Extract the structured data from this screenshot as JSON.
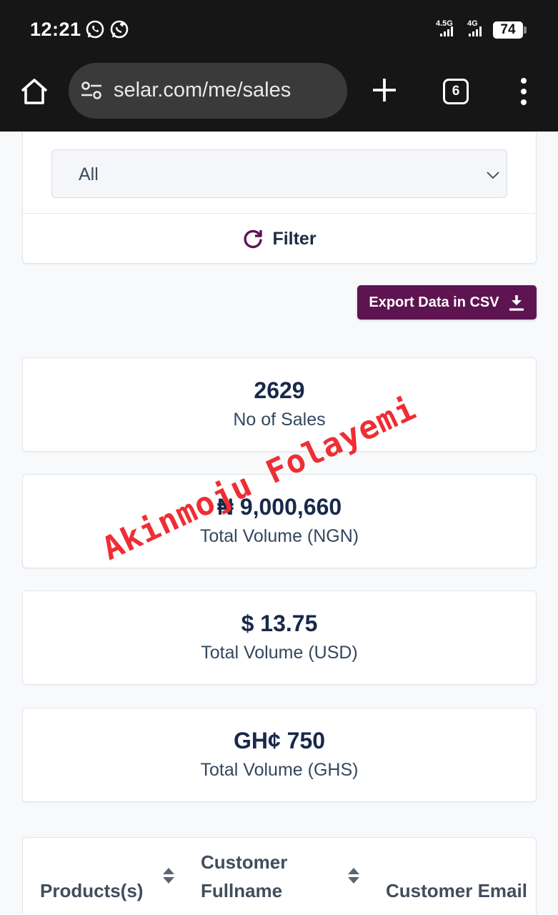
{
  "status_bar": {
    "time": "12:21",
    "net1": "4.5G",
    "net2": "4G",
    "battery": "74",
    "icons": [
      "whatsapp-icon",
      "whatsapp-business-icon"
    ]
  },
  "browser": {
    "url": "selar.com/me/sales",
    "tab_count": "6",
    "icons": [
      "home-icon",
      "site-settings-icon",
      "plus-icon",
      "more-vert-icon"
    ]
  },
  "filter": {
    "select_value": "All",
    "button_label": "Filter"
  },
  "export": {
    "label": "Export Data in CSV"
  },
  "stats": [
    {
      "value": "2629",
      "label": "No of Sales"
    },
    {
      "value": "₦ 9,000,660",
      "label": "Total Volume (NGN)"
    },
    {
      "value": "$ 13.75",
      "label": "Total Volume (USD)"
    },
    {
      "value": "GH¢ 750",
      "label": "Total Volume (GHS)"
    }
  ],
  "table": {
    "headers": [
      "Products(s)",
      "Customer Fullname",
      "Customer Email"
    ],
    "header_lines": {
      "fullname_line1": "Customer",
      "fullname_line2": "Fullname"
    }
  },
  "watermark": "Akinmoju Folayemi",
  "colors": {
    "brand": "#5e1451",
    "dark_text": "#18294a",
    "watermark": "#ee2e34"
  }
}
